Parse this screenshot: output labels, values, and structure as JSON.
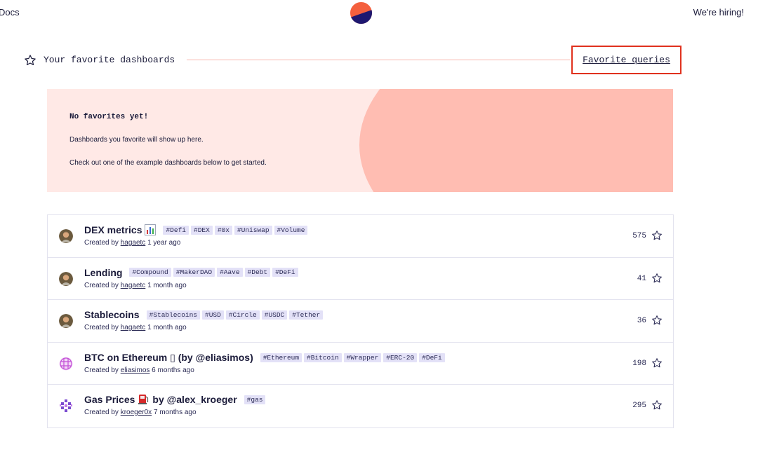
{
  "topbar": {
    "docs_label": "Docs",
    "hiring_label": "We're hiring!"
  },
  "favorites": {
    "title": "Your favorite dashboards",
    "favorite_queries_label": "Favorite queries",
    "empty_title": "No favorites yet!",
    "empty_line1": "Dashboards you favorite will show up here.",
    "empty_line2": "Check out one of the example dashboards below to get started."
  },
  "dashboards": [
    {
      "name": "DEX metrics",
      "icon": "bar-chart-emoji",
      "tags": [
        "#Defi",
        "#DEX",
        "#0x",
        "#Uniswap",
        "#Volume"
      ],
      "created_prefix": "Created by",
      "author": "hagaetc",
      "age": "1 year ago",
      "favorites": "575"
    },
    {
      "name": "Lending",
      "icon": "",
      "tags": [
        "#Compound",
        "#MakerDAO",
        "#Aave",
        "#Debt",
        "#DeFi"
      ],
      "created_prefix": "Created by",
      "author": "hagaetc",
      "age": "1 month ago",
      "favorites": "41"
    },
    {
      "name": "Stablecoins",
      "icon": "",
      "tags": [
        "#Stablecoins",
        "#USD",
        "#Circle",
        "#USDC",
        "#Tether"
      ],
      "created_prefix": "Created by",
      "author": "hagaetc",
      "age": "1 month ago",
      "favorites": "36"
    },
    {
      "name": "BTC on Ethereum ▯ (by @eliasimos)",
      "icon": "",
      "tags": [
        "#Ethereum",
        "#Bitcoin",
        "#Wrapper",
        "#ERC-20",
        "#DeFi"
      ],
      "created_prefix": "Created by",
      "author": "eliasimos",
      "age": "6 months ago",
      "favorites": "198"
    },
    {
      "name": "Gas Prices",
      "name_suffix": "by @alex_kroeger",
      "icon": "fuel-pump-emoji",
      "tags": [
        "#gas"
      ],
      "created_prefix": "Created by",
      "author": "kroeger0x",
      "age": "7 months ago",
      "favorites": "295"
    }
  ],
  "colors": {
    "accent_red": "#e0311e",
    "banner_bg": "#ffe9e6",
    "banner_blob": "#ffbdb2",
    "tag_bg": "#e3e1f7",
    "text": "#1b1b3a"
  }
}
